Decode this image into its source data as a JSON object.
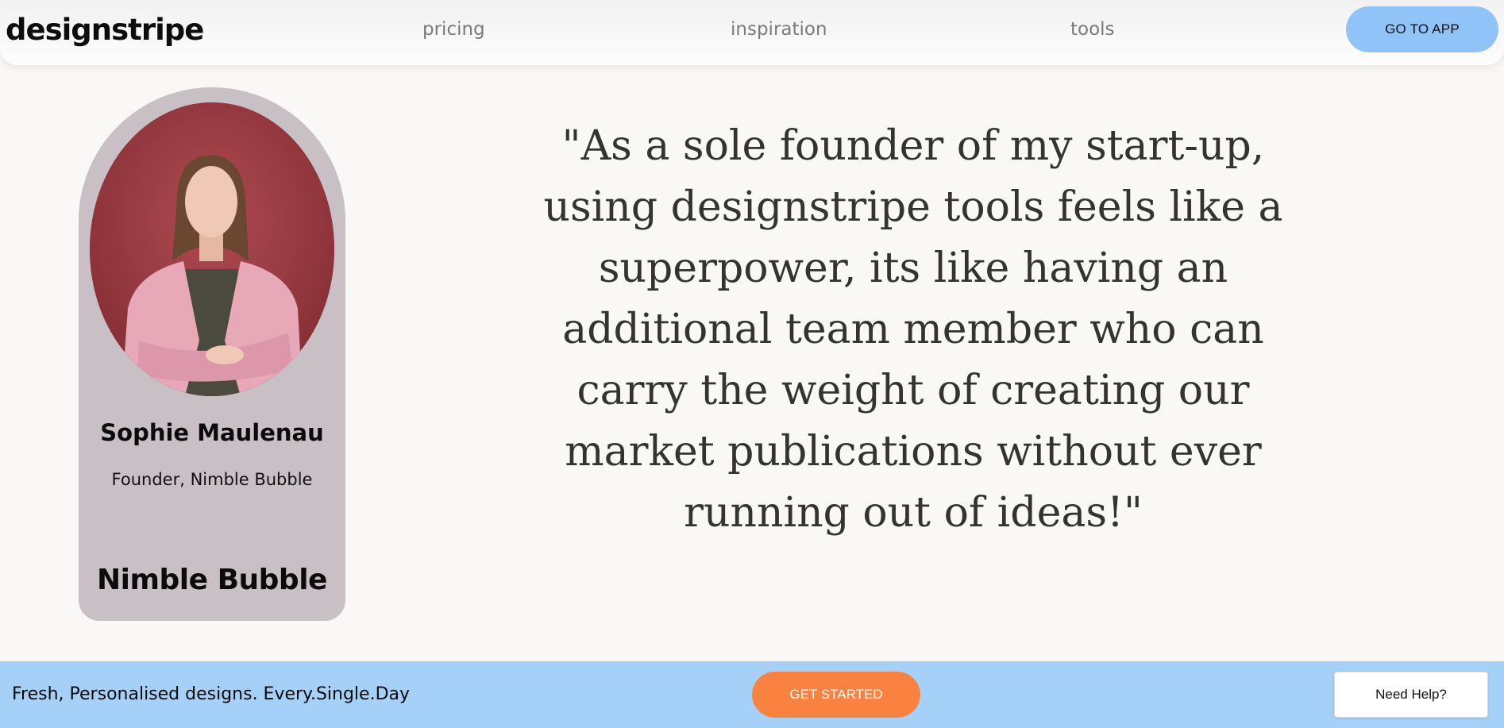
{
  "nav": {
    "logo": "designstripe",
    "links": [
      "pricing",
      "inspiration",
      "tools"
    ],
    "cta_label": "GO TO APP"
  },
  "testimonial": {
    "name": "Sophie Maulenau",
    "role": "Founder, Nimble Bubble",
    "company_logo_text": "Nimble Bubble",
    "quote": "\"As a sole founder of my start-up, using designstripe tools feels like a superpower, its like having an additional team member who can carry the weight of creating our market publications without ever running out of ideas!\""
  },
  "footer_bar": {
    "tagline": "Fresh, Personalised designs. Every.Single.Day",
    "cta_label": "GET STARTED",
    "help_label": "Need Help?"
  },
  "colors": {
    "page_bg": "#f9f8f7",
    "nav_cta": "#90c3f7",
    "card_bg": "#c8c0c4",
    "bottom_bar": "#a5d0f7",
    "get_started": "#f98240"
  }
}
